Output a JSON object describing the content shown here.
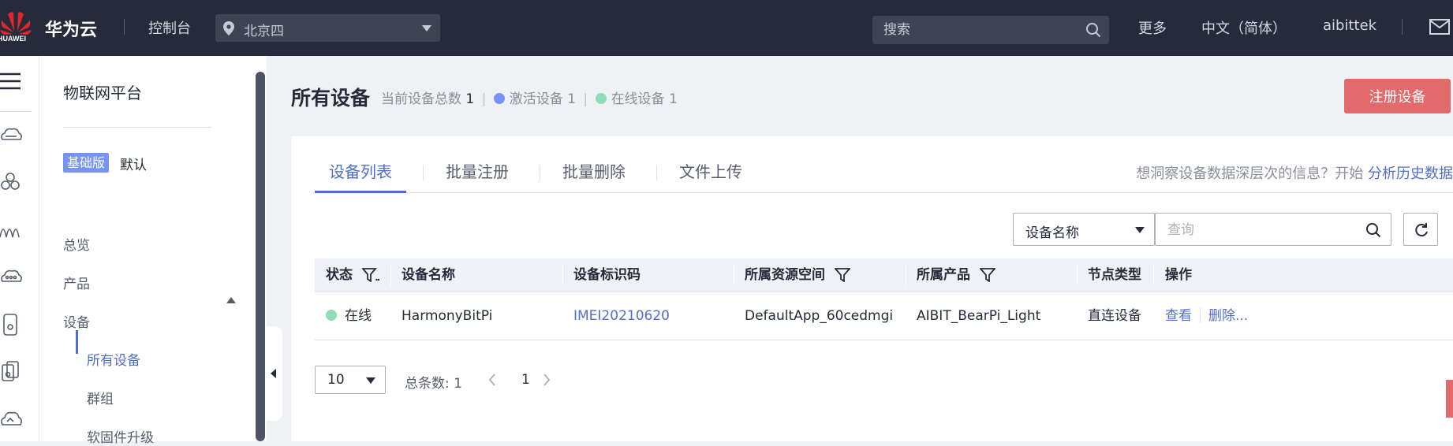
{
  "topbar": {
    "logo_text": "HUAWEI",
    "brand": "华为云",
    "console": "控制台",
    "region": "北京四",
    "search_placeholder": "搜索",
    "more": "更多",
    "language": "中文（简体）",
    "username": "aibittek",
    "icons": [
      "huawei-logo",
      "location-pin-icon",
      "chevron-down-icon",
      "search-icon",
      "mail-icon"
    ]
  },
  "rail": {
    "icons": [
      "menu-icon",
      "cloud-server-icon",
      "cluster-icon",
      "signal-icon",
      "cloud-network-icon",
      "phone-icon",
      "device-icon",
      "cloud-icon"
    ]
  },
  "sidebar": {
    "title": "物联网平台",
    "edition_badge": "基础版",
    "edition_label": "默认",
    "items": {
      "overview": "总览",
      "product": "产品",
      "device": "设备"
    },
    "device_sub": {
      "all_devices": "所有设备",
      "group": "群组",
      "firmware": "软固件升级"
    }
  },
  "page": {
    "title": "所有设备",
    "total_label": "当前设备总数",
    "total_value": "1",
    "active_label": "激活设备",
    "active_value": "1",
    "online_label": "在线设备",
    "online_value": "1",
    "register_button": "注册设备",
    "colors": {
      "accent": "#526ecc",
      "danger": "#e16a6a",
      "active_dot": "#7693f5",
      "online_dot": "#8fdcb7"
    }
  },
  "tabs": [
    "设备列表",
    "批量注册",
    "批量删除",
    "文件上传"
  ],
  "insight": {
    "text": "想洞察设备数据深层次的信息？开始",
    "link": "分析历史数据"
  },
  "filter": {
    "select_value": "设备名称",
    "query_placeholder": "查询"
  },
  "table": {
    "columns": {
      "status": "状态",
      "name": "设备名称",
      "id": "设备标识码",
      "space": "所属资源空间",
      "product": "所属产品",
      "node_type": "节点类型",
      "actions": "操作"
    },
    "rows": [
      {
        "status": "在线",
        "name": "HarmonyBitPi",
        "id": "IMEI20210620",
        "space": "DefaultApp_60cedmgi",
        "product": "AIBIT_BearPi_Light",
        "node_type": "直连设备",
        "view": "查看",
        "delete": "删除..."
      }
    ]
  },
  "pager": {
    "page_size": "10",
    "total": "总条数: 1",
    "current_page": "1"
  }
}
